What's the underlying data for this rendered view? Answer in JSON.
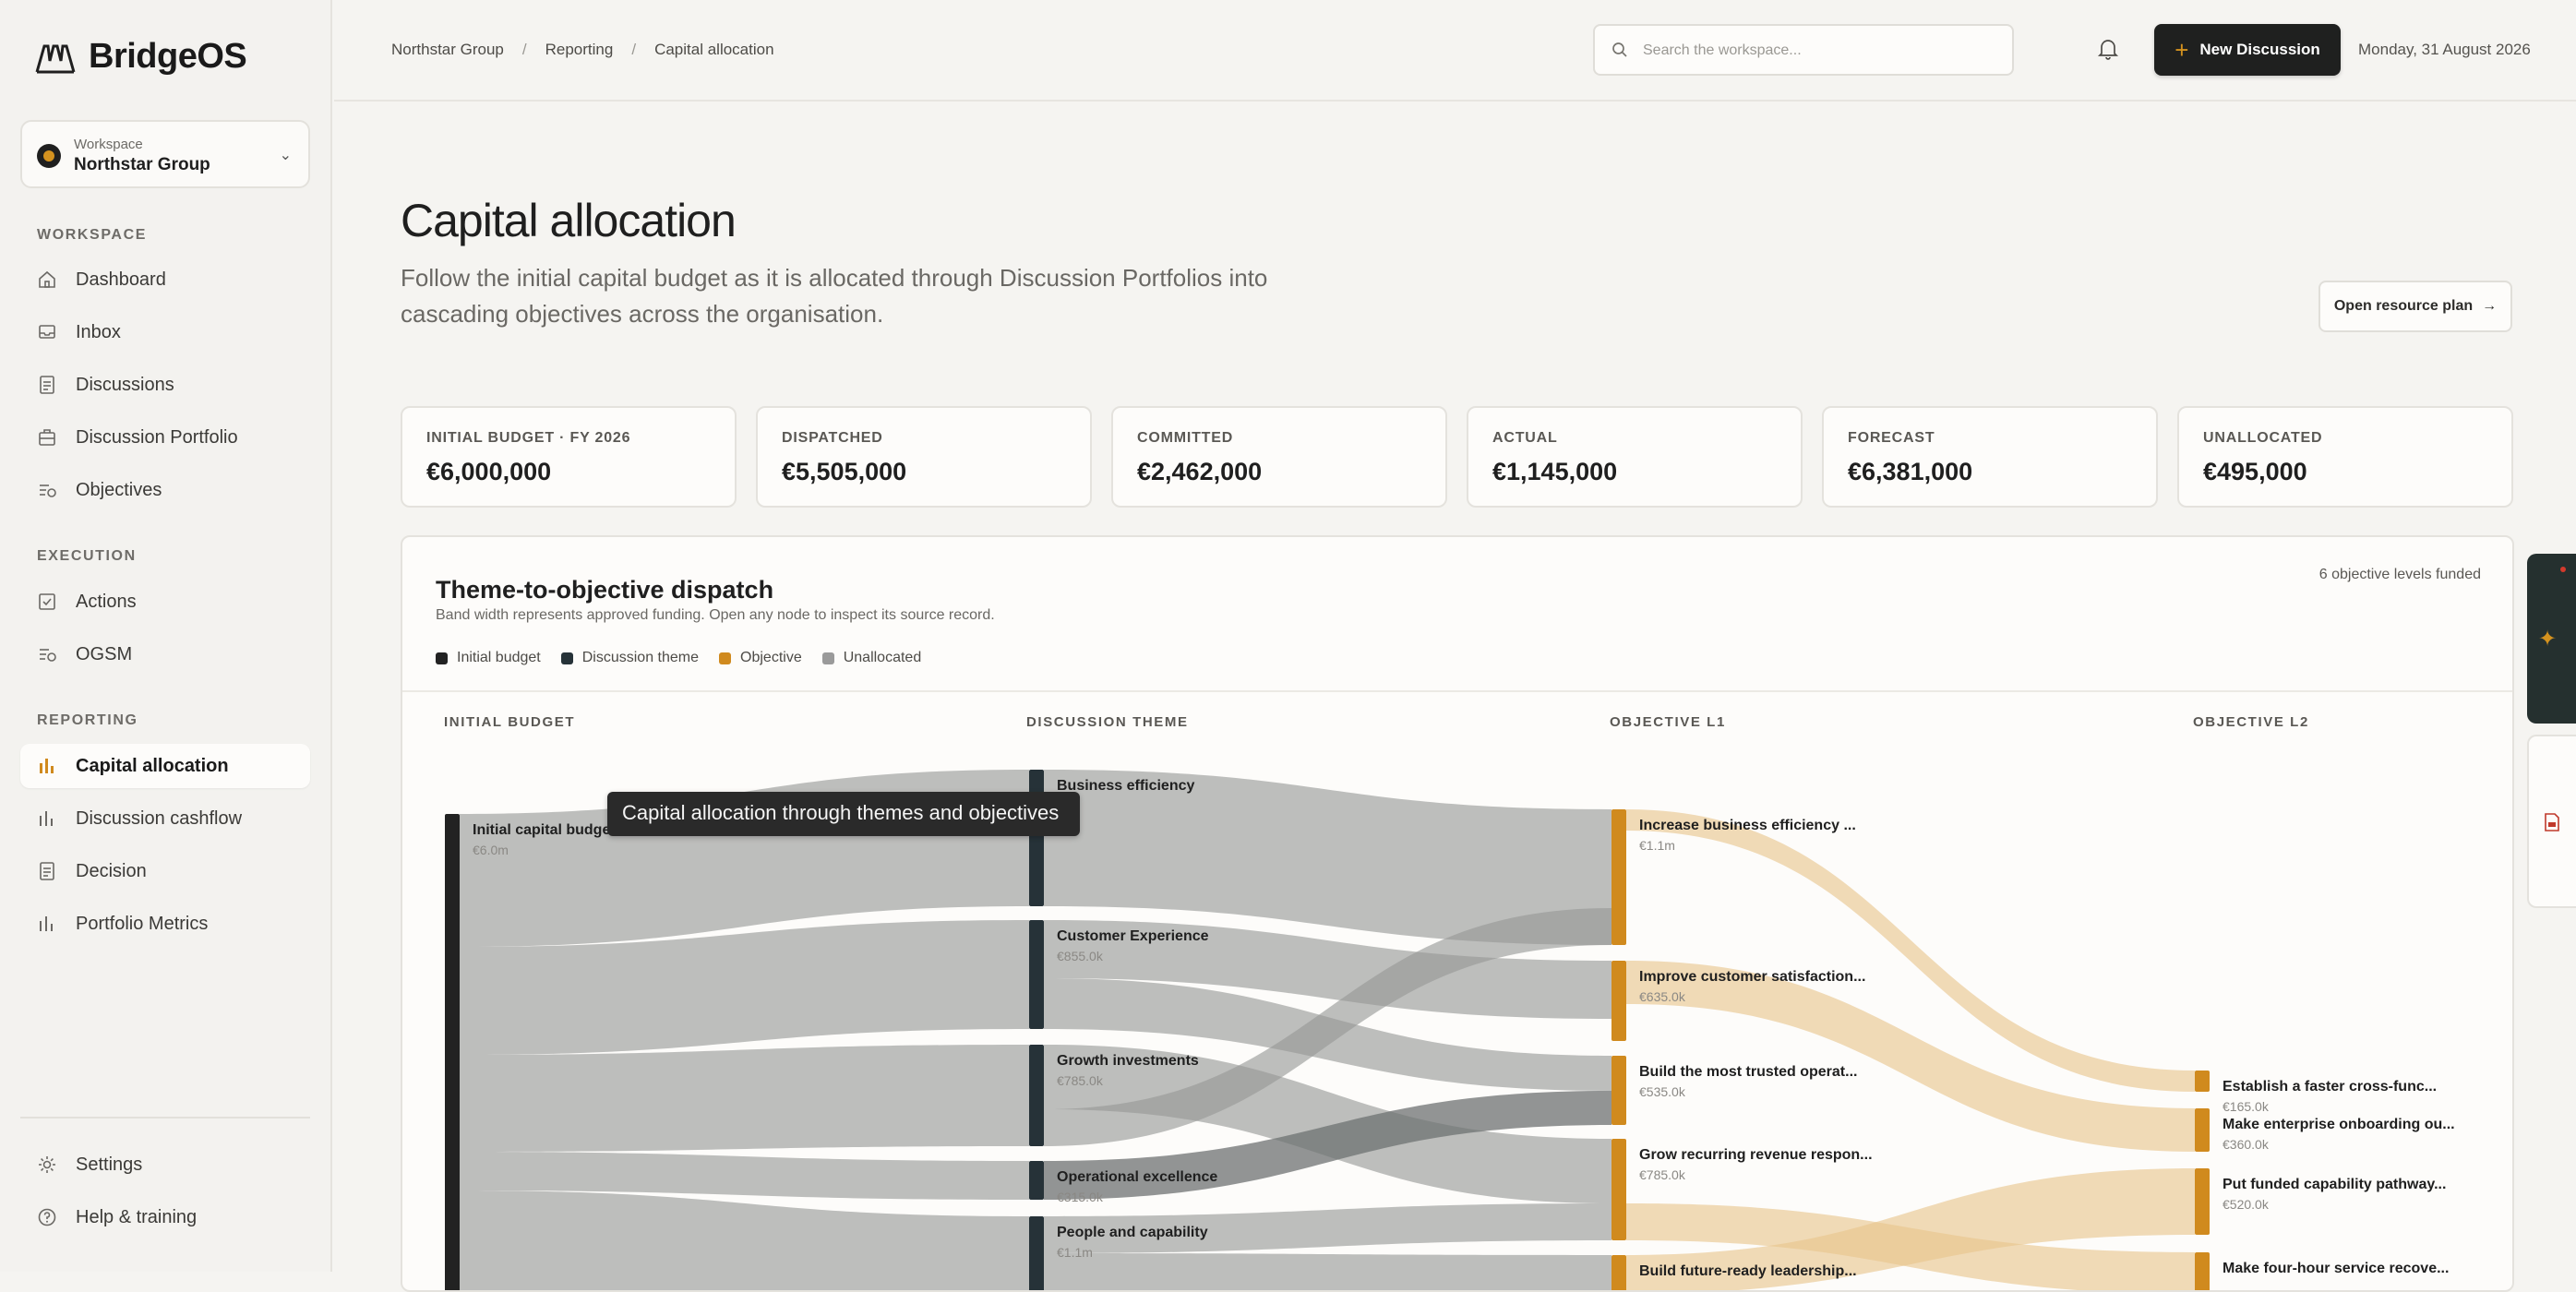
{
  "app": {
    "name": "BridgeOS"
  },
  "workspace": {
    "label": "Workspace",
    "name": "Northstar Group"
  },
  "sidebar": {
    "sections": [
      {
        "title": "WORKSPACE",
        "items": [
          "Dashboard",
          "Inbox",
          "Discussions",
          "Discussion Portfolio",
          "Objectives"
        ]
      },
      {
        "title": "EXECUTION",
        "items": [
          "Actions",
          "OGSM"
        ]
      },
      {
        "title": "REPORTING",
        "items": [
          "Capital allocation",
          "Discussion cashflow",
          "Decision",
          "Portfolio Metrics"
        ]
      }
    ],
    "active_item": "Capital allocation",
    "footer": {
      "settings": "Settings",
      "help": "Help & training"
    }
  },
  "topbar": {
    "breadcrumb": [
      "Northstar Group",
      "Reporting",
      "Capital allocation"
    ],
    "breadcrumb_sep": "/",
    "search_placeholder": "Search the workspace...",
    "new_button": "New Discussion",
    "date": "Monday, 31 August 2026"
  },
  "page": {
    "title": "Capital allocation",
    "subtitle": "Follow the initial capital budget as it is allocated through Discussion Portfolios into cascading objectives across the organisation.",
    "resource_button": "Open resource plan"
  },
  "kpis": [
    {
      "label": "INITIAL BUDGET · FY 2026",
      "value": "€6,000,000"
    },
    {
      "label": "DISPATCHED",
      "value": "€5,505,000"
    },
    {
      "label": "COMMITTED",
      "value": "€2,462,000"
    },
    {
      "label": "ACTUAL",
      "value": "€1,145,000"
    },
    {
      "label": "FORECAST",
      "value": "€6,381,000"
    },
    {
      "label": "UNALLOCATED",
      "value": "€495,000"
    }
  ],
  "panel": {
    "title": "Theme-to-objective dispatch",
    "subtitle": "Band width represents approved funding. Open any node to inspect its source record.",
    "meta": "6 objective levels funded",
    "legend": [
      {
        "label": "Initial budget",
        "color": "#222222"
      },
      {
        "label": "Discussion theme",
        "color": "#263238"
      },
      {
        "label": "Objective",
        "color": "#d08a1e"
      },
      {
        "label": "Unallocated",
        "color": "#9a9a9a"
      }
    ],
    "columns": [
      "INITIAL BUDGET",
      "DISCUSSION THEME",
      "OBJECTIVE L1",
      "OBJECTIVE L2"
    ],
    "tooltip": "Capital allocation through themes and objectives"
  },
  "chart_data": {
    "type": "sankey",
    "unit": "EUR",
    "nodes": [
      {
        "id": "budget",
        "label": "Initial capital budget",
        "value_label": "€6.0m",
        "value": 6000000,
        "level": 0,
        "kind": "budget"
      },
      {
        "id": "t1",
        "label": "Business efficiency",
        "value_label": "",
        "value": 1100000,
        "level": 1,
        "kind": "theme"
      },
      {
        "id": "t2",
        "label": "Customer Experience",
        "value_label": "€855.0k",
        "value": 855000,
        "level": 1,
        "kind": "theme"
      },
      {
        "id": "t3",
        "label": "Growth investments",
        "value_label": "€785.0k",
        "value": 785000,
        "level": 1,
        "kind": "theme"
      },
      {
        "id": "t4",
        "label": "Operational excellence",
        "value_label": "€315.0k",
        "value": 315000,
        "level": 1,
        "kind": "theme"
      },
      {
        "id": "t5",
        "label": "People and capability",
        "value_label": "€1.1m",
        "value": 1100000,
        "level": 1,
        "kind": "theme"
      },
      {
        "id": "o1",
        "label": "Increase business efficiency ...",
        "value_label": "€1.1m",
        "value": 1100000,
        "level": 2,
        "kind": "objective"
      },
      {
        "id": "o2",
        "label": "Improve customer satisfaction...",
        "value_label": "€635.0k",
        "value": 635000,
        "level": 2,
        "kind": "objective"
      },
      {
        "id": "o3",
        "label": "Build the most trusted operat...",
        "value_label": "€535.0k",
        "value": 535000,
        "level": 2,
        "kind": "objective"
      },
      {
        "id": "o4",
        "label": "Grow recurring revenue respon...",
        "value_label": "€785.0k",
        "value": 785000,
        "level": 2,
        "kind": "objective"
      },
      {
        "id": "o5",
        "label": "Build future-ready leadership...",
        "value_label": "",
        "value": 0,
        "level": 2,
        "kind": "objective"
      },
      {
        "id": "p1",
        "label": "Establish a faster cross-func...",
        "value_label": "€165.0k",
        "value": 165000,
        "level": 3,
        "kind": "objective"
      },
      {
        "id": "p2",
        "label": "Make enterprise onboarding ou...",
        "value_label": "€360.0k",
        "value": 360000,
        "level": 3,
        "kind": "objective"
      },
      {
        "id": "p3",
        "label": "Put funded capability pathway...",
        "value_label": "€520.0k",
        "value": 520000,
        "level": 3,
        "kind": "objective"
      },
      {
        "id": "p4",
        "label": "Make four-hour service recove...",
        "value_label": "",
        "value": 0,
        "level": 3,
        "kind": "objective"
      }
    ]
  }
}
